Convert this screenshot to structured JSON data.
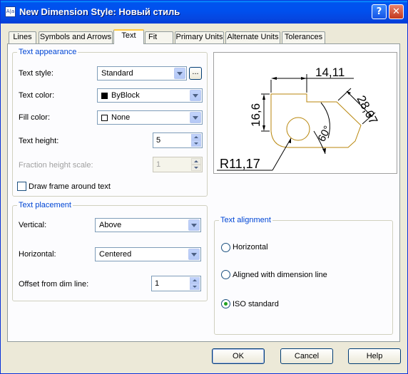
{
  "window": {
    "title": "New Dimension Style: Новый стиль",
    "app_icon_text": "A|a",
    "help_glyph": "?",
    "close_glyph": "✕"
  },
  "tabs": [
    {
      "label": "Lines"
    },
    {
      "label": "Symbols and Arrows"
    },
    {
      "label": "Text",
      "active": true
    },
    {
      "label": "Fit"
    },
    {
      "label": "Primary Units"
    },
    {
      "label": "Alternate Units"
    },
    {
      "label": "Tolerances"
    }
  ],
  "text_appearance": {
    "title": "Text appearance",
    "text_style": {
      "label": "Text style:",
      "value": "Standard",
      "browse": "..."
    },
    "text_color": {
      "label": "Text color:",
      "value": "ByBlock",
      "swatch": "#000000"
    },
    "fill_color": {
      "label": "Fill color:",
      "value": "None",
      "swatch": "#ffffff"
    },
    "text_height": {
      "label": "Text height:",
      "value": "5"
    },
    "fraction_height_scale": {
      "label": "Fraction height scale:",
      "value": "1"
    },
    "draw_frame": {
      "label": "Draw frame around text",
      "checked": false
    }
  },
  "preview": {
    "dim_top": "14,11",
    "dim_left": "16,6",
    "dim_right": "28,07",
    "dim_angle": "60°",
    "dim_radius": "R11,17"
  },
  "text_placement": {
    "title": "Text placement",
    "vertical": {
      "label": "Vertical:",
      "value": "Above"
    },
    "horizontal": {
      "label": "Horizontal:",
      "value": "Centered"
    },
    "offset": {
      "label": "Offset from dim line:",
      "value": "1"
    }
  },
  "text_alignment": {
    "title": "Text alignment",
    "options": [
      {
        "label": "Horizontal",
        "selected": false
      },
      {
        "label": "Aligned with dimension line",
        "selected": false
      },
      {
        "label": "ISO standard",
        "selected": true
      }
    ]
  },
  "buttons": {
    "ok": "OK",
    "cancel": "Cancel",
    "help": "Help"
  },
  "colors": {
    "title_bar": "#0053ee",
    "group_title": "#0046d5",
    "geometry": "#b8860b",
    "active_tab_accent": "#ffc83c"
  }
}
